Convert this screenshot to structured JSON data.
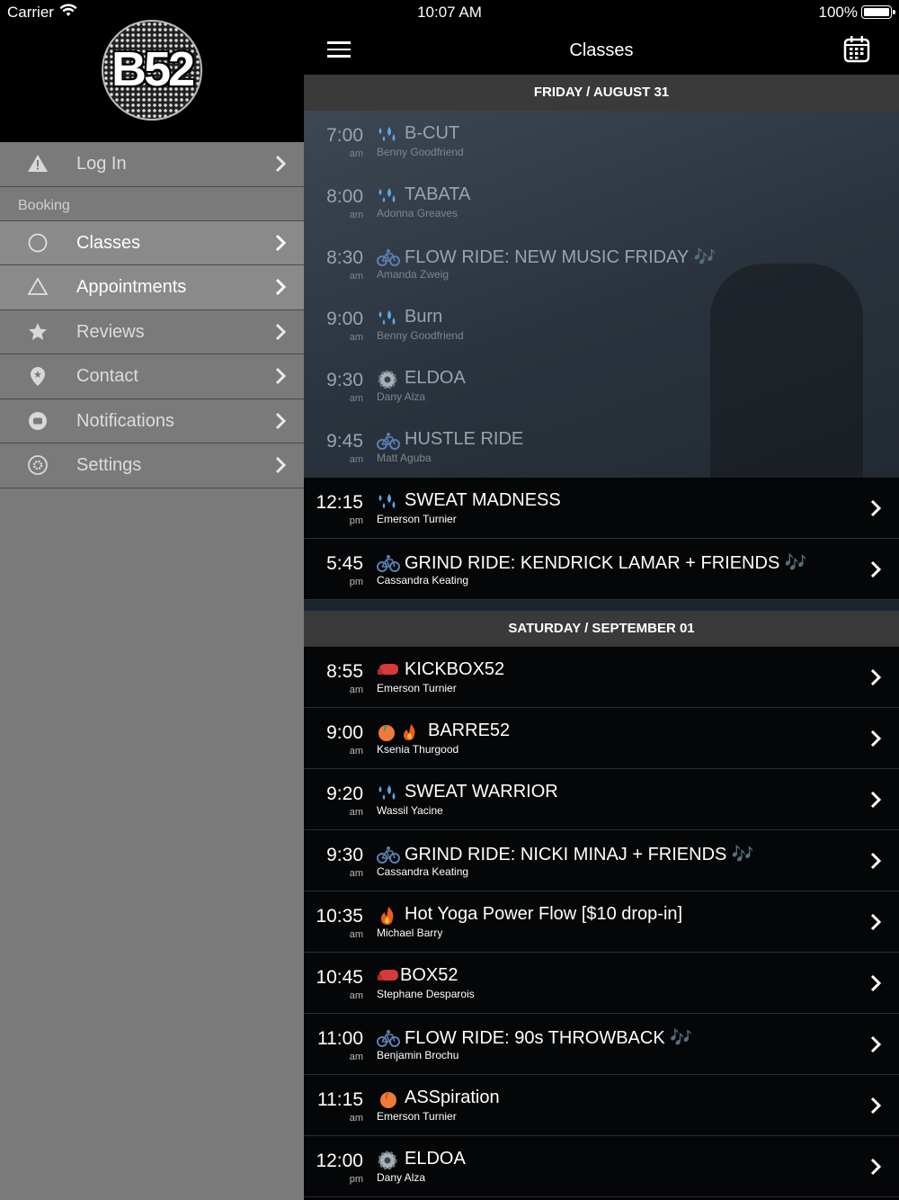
{
  "status_bar": {
    "carrier": "Carrier",
    "time": "10:07 AM",
    "battery": "100%"
  },
  "sidebar": {
    "logo_text": "B52",
    "login": "Log In",
    "section": "Booking",
    "items": [
      {
        "label": "Classes",
        "icon": "circle-icon"
      },
      {
        "label": "Appointments",
        "icon": "triangle-icon"
      },
      {
        "label": "Reviews",
        "icon": "star-icon"
      },
      {
        "label": "Contact",
        "icon": "location-pin-icon"
      },
      {
        "label": "Notifications",
        "icon": "chat-bubble-icon"
      },
      {
        "label": "Settings",
        "icon": "gear-icon"
      }
    ]
  },
  "navbar": {
    "title": "Classes"
  },
  "days": [
    {
      "header": "FRIDAY / AUGUST 31",
      "classes": [
        {
          "time": "7:00",
          "ampm": "am",
          "icon": "droplets-icon",
          "title": "B-CUT",
          "instructor": "Benny Goodfriend",
          "past": true
        },
        {
          "time": "8:00",
          "ampm": "am",
          "icon": "droplets-icon",
          "title": "TABATA",
          "instructor": "Adonna Greaves",
          "past": true
        },
        {
          "time": "8:30",
          "ampm": "am",
          "icon": "bicycle-icon",
          "title": "FLOW RIDE: NEW MUSIC FRIDAY 🎶",
          "instructor": "Amanda Zweig",
          "past": true
        },
        {
          "time": "9:00",
          "ampm": "am",
          "icon": "droplets-icon",
          "title": "Burn",
          "instructor": "Benny Goodfriend",
          "past": true
        },
        {
          "time": "9:30",
          "ampm": "am",
          "icon": "gear-emoji-icon",
          "title": "ELDOA",
          "instructor": "Dany Alza",
          "past": true
        },
        {
          "time": "9:45",
          "ampm": "am",
          "icon": "bicycle-icon",
          "title": "HUSTLE RIDE",
          "instructor": "Matt Aguba",
          "past": true
        },
        {
          "time": "12:15",
          "ampm": "pm",
          "icon": "droplets-icon",
          "title": "SWEAT MADNESS",
          "instructor": "Emerson Turnier",
          "past": false
        },
        {
          "time": "5:45",
          "ampm": "pm",
          "icon": "bicycle-icon",
          "title": "GRIND RIDE: KENDRICK LAMAR + FRIENDS 🎶",
          "instructor": "Cassandra Keating",
          "past": false
        }
      ]
    },
    {
      "header": "SATURDAY / SEPTEMBER 01",
      "classes": [
        {
          "time": "8:55",
          "ampm": "am",
          "icon": "boxing-glove-icon",
          "title": "KICKBOX52",
          "instructor": "Emerson Turnier",
          "past": false
        },
        {
          "time": "9:00",
          "ampm": "am",
          "icon": "peach-fire-icon",
          "title": "BARRE52",
          "instructor": "Ksenia Thurgood",
          "past": false
        },
        {
          "time": "9:20",
          "ampm": "am",
          "icon": "droplets-icon",
          "title": "SWEAT WARRIOR",
          "instructor": "Wassil Yacine",
          "past": false
        },
        {
          "time": "9:30",
          "ampm": "am",
          "icon": "bicycle-icon",
          "title": "GRIND RIDE: NICKI MINAJ + FRIENDS 🎶",
          "instructor": "Cassandra Keating",
          "past": false
        },
        {
          "time": "10:35",
          "ampm": "am",
          "icon": "fire-icon",
          "title": "Hot Yoga Power Flow [$10 drop-in]",
          "instructor": "Michael Barry",
          "past": false
        },
        {
          "time": "10:45",
          "ampm": "am",
          "icon": "boxing-glove-icon",
          "title": "BOX52",
          "instructor": "Stephane Desparois",
          "past": false
        },
        {
          "time": "11:00",
          "ampm": "am",
          "icon": "bicycle-icon",
          "title": "FLOW RIDE: 90s THROWBACK 🎶",
          "instructor": "Benjamin Brochu",
          "past": false
        },
        {
          "time": "11:15",
          "ampm": "am",
          "icon": "peach-icon",
          "title": "ASSpiration",
          "instructor": "Emerson Turnier",
          "past": false
        },
        {
          "time": "12:00",
          "ampm": "pm",
          "icon": "gear-emoji-icon",
          "title": "ELDOA",
          "instructor": "Dany Alza",
          "past": false
        }
      ]
    }
  ]
}
